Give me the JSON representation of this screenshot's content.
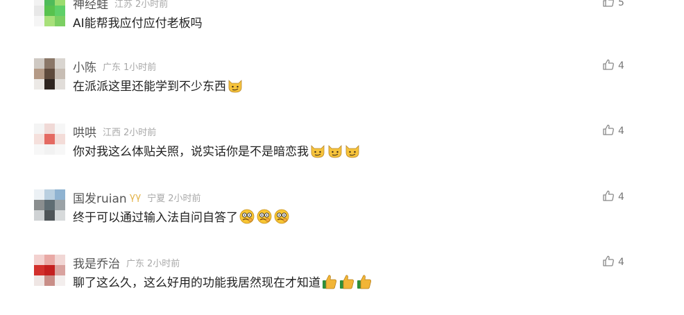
{
  "comments": [
    {
      "username": "神经蛙",
      "location": "江苏",
      "time": "2小时前",
      "text": "AI能帮我应付应付老板吗",
      "emojis": [],
      "likes": "5",
      "avatar_colors": [
        "#f2f2f2",
        "#4fbb5a",
        "#9bdc6f",
        "#e8e8e8",
        "#58c24e",
        "#5fd068",
        "#f5f5f5",
        "#a8e07a",
        "#7ccf63"
      ]
    },
    {
      "username": "小陈",
      "location": "广东",
      "time": "1小时前",
      "text": "在派派这里还能学到不少东西",
      "emojis": [
        "smirk-cat"
      ],
      "likes": "4",
      "avatar_colors": [
        "#cfc9c3",
        "#8a7768",
        "#d9d5d0",
        "#b49a86",
        "#5e4a3c",
        "#c7bdb4",
        "#ece9e6",
        "#2f2520",
        "#e1ddd9"
      ]
    },
    {
      "username": "哄哄",
      "location": "江西",
      "time": "2小时前",
      "text": "你对我这么体贴关照，说实话你是不是暗恋我",
      "emojis": [
        "smirk-cat",
        "smirk-cat",
        "smirk-cat"
      ],
      "likes": "4",
      "avatar_colors": [
        "#f4f4f4",
        "#f0d9d6",
        "#f6f6f6",
        "#f5e0dc",
        "#e46a62",
        "#f3dcd8",
        "#f7f7f7",
        "#f2f2f2",
        "#f7f7f7"
      ]
    },
    {
      "username": "国发ruian",
      "badge": "γγ",
      "location": "宁夏",
      "time": "2小时前",
      "text": "终于可以通过输入法自问自答了",
      "emojis": [
        "think-face",
        "think-face",
        "think-face"
      ],
      "likes": "4",
      "avatar_colors": [
        "#ecf1f5",
        "#b9cfe0",
        "#8fb3d1",
        "#8a8e8f",
        "#5f6d73",
        "#9aa2a6",
        "#cfd2d4",
        "#4e5457",
        "#d7dadb"
      ]
    },
    {
      "username": "我是乔治",
      "location": "广东",
      "time": "2小时前",
      "text": "聊了这么久，这么好用的功能我居然现在才知道",
      "emojis": [
        "thumbs-up",
        "thumbs-up",
        "thumbs-up"
      ],
      "likes": "4",
      "avatar_colors": [
        "#f3d1cf",
        "#e9a9a5",
        "#f1d7d5",
        "#d2302c",
        "#c41f1f",
        "#d9a39f",
        "#efe6e4",
        "#c98e88",
        "#f3eeed"
      ]
    }
  ]
}
